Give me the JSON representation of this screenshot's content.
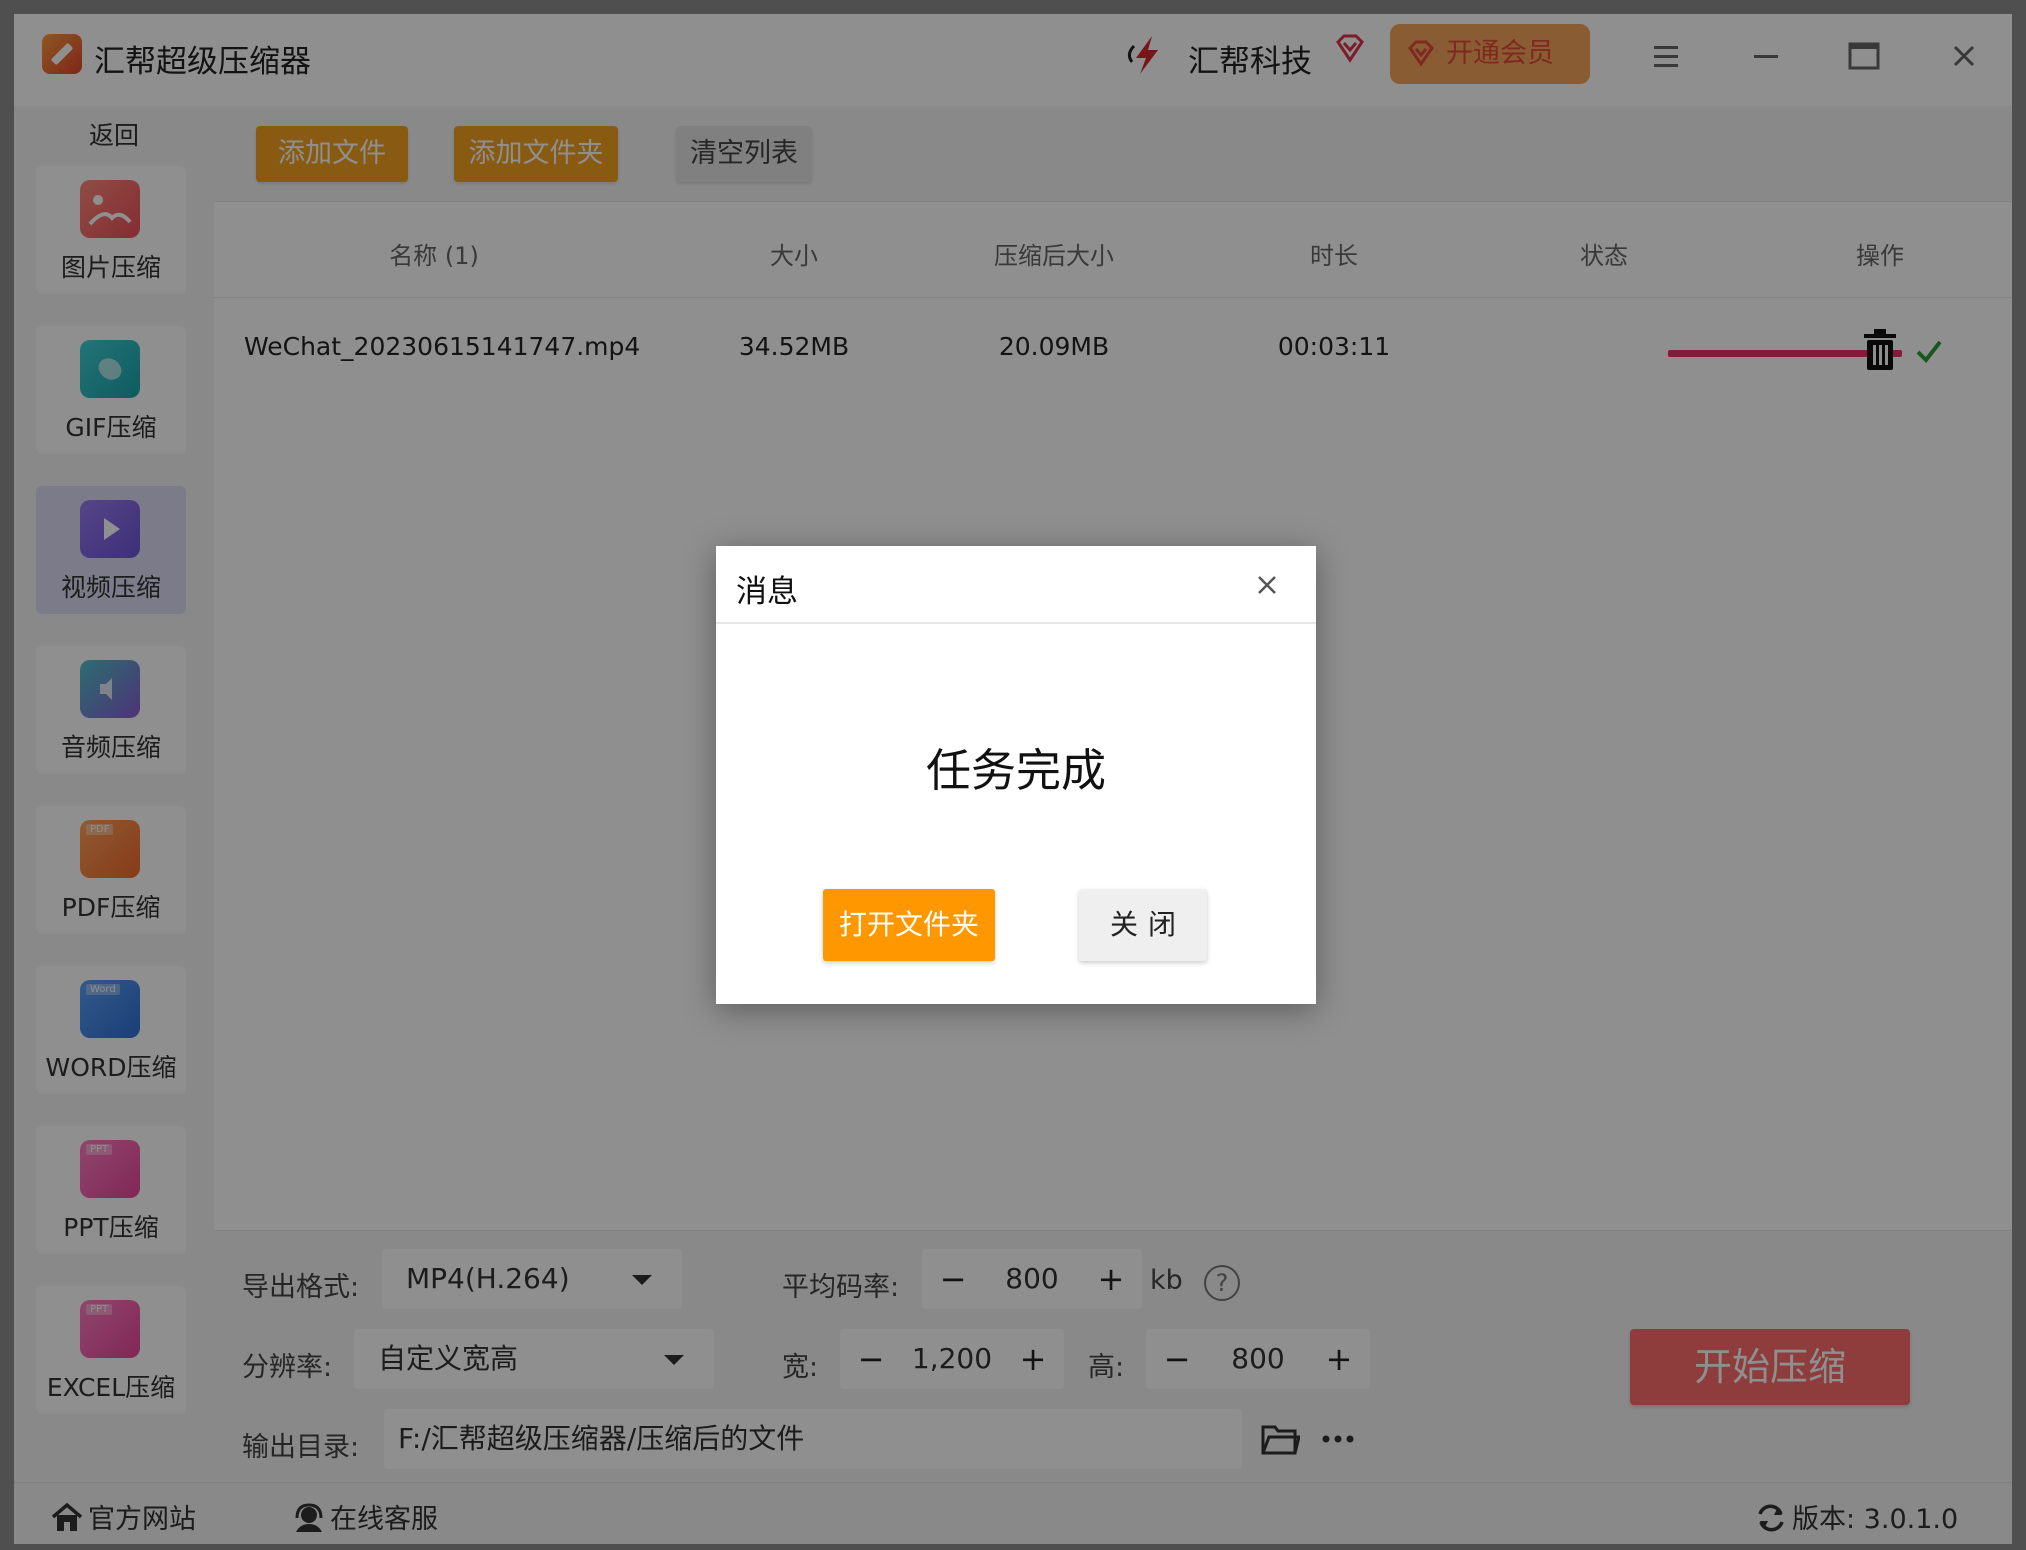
{
  "app": {
    "title": "汇帮超级压缩器",
    "brand": "汇帮科技",
    "vip_label": "开通会员"
  },
  "sidebar": {
    "back": "返回",
    "items": [
      {
        "label": "图片压缩",
        "icon": "image-icon",
        "active": false
      },
      {
        "label": "GIF压缩",
        "icon": "gif-icon",
        "active": false
      },
      {
        "label": "视频压缩",
        "icon": "video-play-icon",
        "active": true
      },
      {
        "label": "音频压缩",
        "icon": "audio-speaker-icon",
        "active": false
      },
      {
        "label": "PDF压缩",
        "icon": "pdf-file-icon",
        "tag": "PDF",
        "active": false
      },
      {
        "label": "WORD压缩",
        "icon": "word-file-icon",
        "tag": "Word",
        "active": false
      },
      {
        "label": "PPT压缩",
        "icon": "ppt-file-icon",
        "tag": "PPT",
        "active": false
      },
      {
        "label": "EXCEL压缩",
        "icon": "excel-file-icon",
        "tag": "PPT",
        "active": false
      }
    ]
  },
  "toolbar": {
    "add_file": "添加文件",
    "add_folder": "添加文件夹",
    "clear_list": "清空列表"
  },
  "table": {
    "columns": [
      "名称 (1)",
      "大小",
      "压缩后大小",
      "时长",
      "状态",
      "操作"
    ],
    "rows": [
      {
        "name": "WeChat_20230615141747.mp4",
        "size": "34.52MB",
        "compressed": "20.09MB",
        "duration": "00:03:11",
        "progress": 1.0
      }
    ]
  },
  "settings": {
    "format_label": "导出格式:",
    "format_value": "MP4(H.264)",
    "bitrate_label": "平均码率:",
    "bitrate_value": "800",
    "bitrate_unit": "kb",
    "resolution_label": "分辨率:",
    "resolution_value": "自定义宽高",
    "width_label": "宽:",
    "width_value": "1,200",
    "height_label": "高:",
    "height_value": "800",
    "output_label": "输出目录:",
    "output_value": "F:/汇帮超级压缩器/压缩后的文件",
    "start_label": "开始压缩"
  },
  "footer": {
    "website": "官方网站",
    "support": "在线客服",
    "version": "版本: 3.0.1.0"
  },
  "dialog": {
    "title": "消息",
    "message": "任务完成",
    "open_folder": "打开文件夹",
    "close": "关闭"
  },
  "colors": {
    "accent_orange": "#f5a021",
    "progress": "#e8326d",
    "start_button": "#ff6b6b",
    "active_sidebar": "#dedcf7"
  }
}
